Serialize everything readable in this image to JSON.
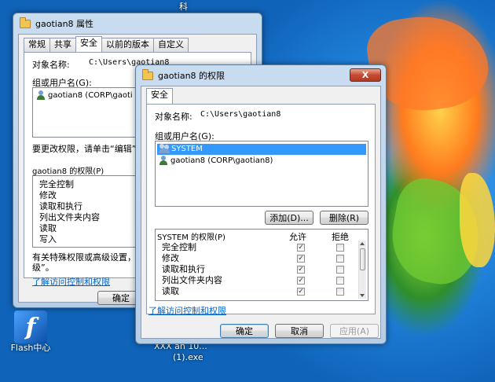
{
  "desktop": {
    "top_char": "科",
    "flash_label": "Flash中心",
    "exe_label_line1": "XXX an 10...",
    "exe_label_line2": "(1).exe"
  },
  "props_window": {
    "title": "gaotian8 属性",
    "tabs": [
      "常规",
      "共享",
      "安全",
      "以前的版本",
      "自定义"
    ],
    "object_name_label": "对象名称:",
    "object_name_value": "C:\\Users\\gaotian8",
    "group_label": "组或用户名(G):",
    "users": [
      "gaotian8 (CORP\\gaoti"
    ],
    "change_hint": "要更改权限，请单击“编辑”",
    "perm_label": "gaotian8 的权限(P)",
    "permissions": [
      "完全控制",
      "修改",
      "读取和执行",
      "列出文件夹内容",
      "读取",
      "写入"
    ],
    "special_hint_line1": "有关特殊权限或高级设置，请",
    "special_hint_line2": "级”。",
    "learn_link": "了解访问控制和权限",
    "ok_label": "确定"
  },
  "perm_window": {
    "title": "gaotian8 的权限",
    "close_label": "X",
    "tab": "安全",
    "object_name_label": "对象名称:",
    "object_name_value": "C:\\Users\\gaotian8",
    "group_label": "组或用户名(G):",
    "users": [
      {
        "name": "SYSTEM",
        "selected": true,
        "icon": "group-icon"
      },
      {
        "name": "gaotian8 (CORP\\gaotian8)",
        "selected": false,
        "icon": "user-icon"
      }
    ],
    "add_label": "添加(D)...",
    "remove_label": "删除(R)",
    "perm_label": "SYSTEM 的权限(P)",
    "allow_header": "允许",
    "deny_header": "拒绝",
    "permissions": [
      {
        "name": "完全控制",
        "allow": true,
        "deny": false
      },
      {
        "name": "修改",
        "allow": true,
        "deny": false
      },
      {
        "name": "读取和执行",
        "allow": true,
        "deny": false
      },
      {
        "name": "列出文件夹内容",
        "allow": true,
        "deny": false
      },
      {
        "name": "读取",
        "allow": true,
        "deny": false
      }
    ],
    "learn_link": "了解访问控制和权限",
    "ok_label": "确定",
    "cancel_label": "取消",
    "apply_label": "应用(A)"
  }
}
